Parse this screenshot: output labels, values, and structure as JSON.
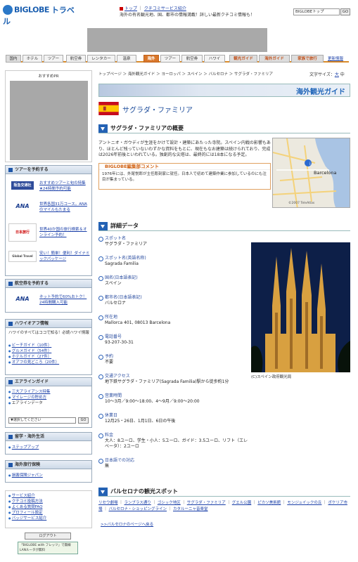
{
  "header": {
    "logo_text": "BIGLOBE",
    "logo_sub": "トラベル",
    "links": [
      "トップ",
      "クチコミサービス紹介"
    ],
    "message": "海外の有名観光地、国、都市の情報満載！詳しい最新クチコミ情報も！",
    "select_value": "BIGLOBEトップ",
    "go": "GO"
  },
  "nav": {
    "domestic": "国内",
    "hotel": "ホテル",
    "tour": "ツアー",
    "air": "航空券",
    "car": "レンタカー",
    "onsen": "温泉",
    "overseas": "海外",
    "ov_tour": "ツアー",
    "ov_air": "航空券",
    "hawaii": "ハワイ",
    "guide1": "観光ガイド",
    "guide2": "海外ガイド",
    "family": "家族で旅行",
    "updates": "更新情報"
  },
  "left": {
    "pr_title": "おすすめPR",
    "tour_title": "ツアーを予約する",
    "tours": [
      {
        "logo": "阪急交通社",
        "text": "おすすめツアーと旬の特集★24時間予約可能"
      },
      {
        "logo": "ANA",
        "text": "世界各国31万コース。ANAのマイルもたまる"
      },
      {
        "logo": "日本旅行",
        "text": "世界40か国の旅行検索＆オンライン予約！"
      },
      {
        "logo": "Global Travel",
        "text": "安い！簡単！便利！ダイナミックパッケージ"
      }
    ],
    "air_title": "航空券を予約する",
    "air_item": {
      "logo": "ANA",
      "text": "ネット予約で60%おトク！24時間購入可能"
    },
    "hawaii_title": "ハワイオアフ情報",
    "hawaii_intro": "ハワイのすべてはココで知る！必読ハワイ情報",
    "hawaii_links": [
      "ビーチガイド（10件）",
      "グルメガイド（54件）",
      "ホテルガイド（27件）",
      "オアフの見どころ（20件）"
    ],
    "airline_title": "エアラインガイド",
    "airline_links": [
      "三大アライアンス特集",
      "マイレージの貯め方",
      "エアラインデータ"
    ],
    "airline_select": "▼選択してください",
    "study_title": "留学・海外生活",
    "study_link": "ステップアップ",
    "ins_title": "海外旅行保険",
    "ins_link": "損害保険ジャパン",
    "service_links": [
      "サービス紹介",
      "クチコミ投稿方法",
      "よくある質問FAQ",
      "プロフィール設定",
      "バッジサービス紹介"
    ],
    "login": "ログアウト",
    "ad_text": "「BIGLOBE with フレッツ」で無線LANルータが無料"
  },
  "main": {
    "breadcrumb": "トップページ ＞ 海外観光ガイド ＞ ヨーロッパ ＞ スペイン ＞ バルセロナ ＞ サグラダ・ファミリア",
    "font_size": "文字サイズ：",
    "font_large": "大",
    "font_mid": "中",
    "banner": "海外観光ガイド",
    "title": "サグラダ・ファミリア",
    "overview_h": "サグラダ・ファミリアの概要",
    "description": "アントニオ・ガウディが生涯をかけて設計・建築にあたった寺院。スペイン内戦の影響もあり、ほとんど残っていないわずかな資料をもとに、現在もなお建築は続けられており、完成は2026年前後といわれている。独創的な尖塔は、最終的には18本になる予定。",
    "editor_h": "BIGLOBE編集部コメント",
    "editor_text": "1976年には、外尾悦郎が主任彫刻家に就任。日本人で初めて建築作業に参加しているのにも注目が集まっている。",
    "map_city": "Barcelona",
    "map_credit": "©2007 TeleAtlas",
    "detail_h": "詳細データ",
    "details": [
      {
        "label": "スポット名",
        "value": "サグラダ・ファミリア"
      },
      {
        "label": "スポット名(英語名称)",
        "value": "Sagrada Familia"
      },
      {
        "label": "国名(日本語表記)",
        "value": "スペイン"
      },
      {
        "label": "都市名(日本語表記)",
        "value": "バルセロナ"
      },
      {
        "label": "所在地",
        "value": "Mallorca 401, 08013 Barcelona"
      },
      {
        "label": "電話番号",
        "value": "93-207-30-31"
      },
      {
        "label": "予約",
        "value": "不要"
      },
      {
        "label": "交通アクセス",
        "value": "地下鉄サグラダ・ファミリア(Sagrada Familia)駅から徒歩約1分"
      },
      {
        "label": "営業時間",
        "value": "10～3月／9:00～18:00、4～9月／9:00～20:00"
      },
      {
        "label": "休業日",
        "value": "12月25・26日、1月1日、6日の午後"
      },
      {
        "label": "料金",
        "value": "大人：8ユーロ、学生・小人：5ユーロ、ガイド：3.5ユーロ、リフト（エレベータ）：2ユーロ"
      },
      {
        "label": "日本語での対応",
        "value": "無"
      }
    ],
    "photo_caption": "(C)スペイン政府観光局",
    "spots_h": "バルセロナの観光スポット",
    "spots": [
      "リセウ劇場",
      "ランブラス通り",
      "ゴシック地区",
      "サグラダ・ファミリア",
      "グエル公園",
      "ピカソ美術館",
      "モンジュイックの丘",
      "ボケリア市場",
      "バルセロナ・ショッピングライン",
      "カタルーニャ音楽堂"
    ],
    "back_link": ">>バルセロナのページへ戻る"
  },
  "colors": {
    "accent": "#d9772b",
    "link": "#1a3fa8",
    "brand": "#1b5fb0"
  }
}
